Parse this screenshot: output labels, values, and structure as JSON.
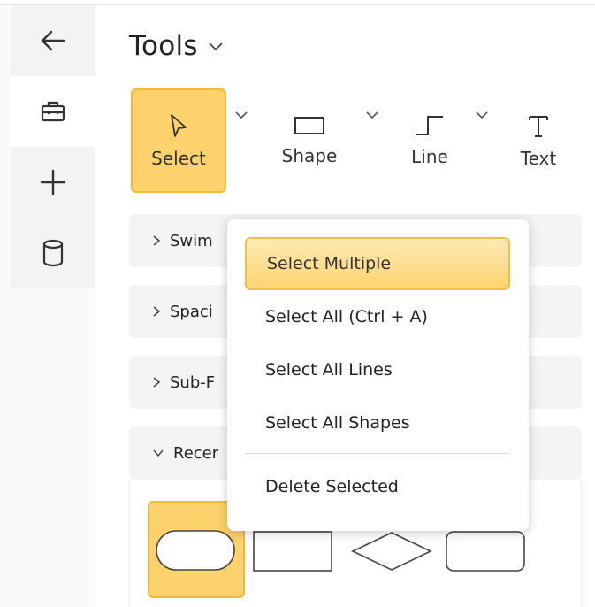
{
  "rail": {
    "items": [
      {
        "icon": "back-arrow-icon"
      },
      {
        "icon": "toolbox-icon"
      },
      {
        "icon": "plus-icon"
      },
      {
        "icon": "database-icon"
      }
    ]
  },
  "header": {
    "title": "Tools"
  },
  "toolbar": {
    "select_label": "Select",
    "shape_label": "Shape",
    "line_label": "Line",
    "text_label": "Text"
  },
  "sections": [
    {
      "label": "Swim",
      "expanded": false
    },
    {
      "label": "Spaci",
      "expanded": false
    },
    {
      "label": "Sub-F",
      "expanded": false
    },
    {
      "label": "Recer",
      "expanded": true
    }
  ],
  "menu": {
    "items": [
      {
        "label": "Select Multiple",
        "highlighted": true
      },
      {
        "label": "Select All (Ctrl + A)"
      },
      {
        "label": "Select All Lines"
      },
      {
        "label": "Select All Shapes"
      },
      {
        "label": "Delete Selected"
      }
    ]
  },
  "colors": {
    "accent": "#fdd26c",
    "accent_border": "#f0b93a",
    "section_bg": "#f4f4f4"
  }
}
